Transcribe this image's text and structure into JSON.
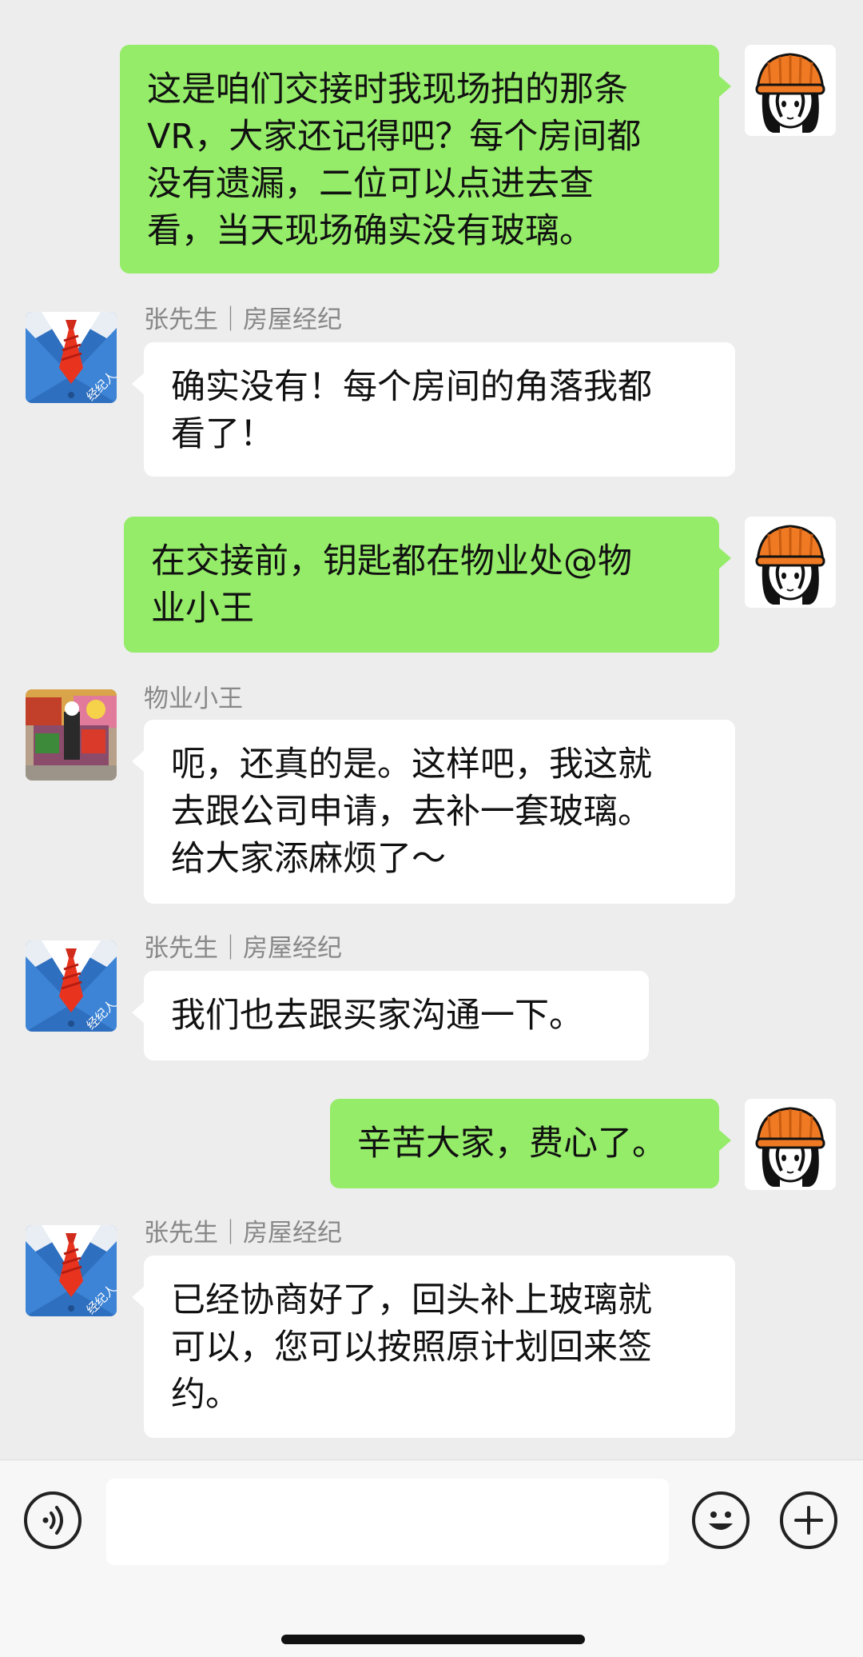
{
  "messages": [
    {
      "direction": "out",
      "sender": "",
      "avatar": "orange-hat-girl-avatar",
      "lines": [
        "这是咱们交接时我现场拍的那条",
        "VR，大家还记得吧？每个房间都",
        "没有遗漏，二位可以点进去查",
        "看，当天现场确实没有玻璃。"
      ]
    },
    {
      "direction": "in",
      "sender": "张先生｜房屋经纪",
      "avatar": "agent-suit-avatar",
      "lines": [
        "确实没有！每个房间的角落我都",
        "看了！"
      ]
    },
    {
      "direction": "out",
      "sender": "",
      "avatar": "orange-hat-girl-avatar",
      "lines": [
        "在交接前，钥匙都在物业处@物",
        "业小王"
      ]
    },
    {
      "direction": "in",
      "sender": "物业小王",
      "avatar": "photo-avatar",
      "lines": [
        "呃，还真的是。这样吧，我这就",
        "去跟公司申请，去补一套玻璃。",
        "给大家添麻烦了～"
      ]
    },
    {
      "direction": "in",
      "sender": "张先生｜房屋经纪",
      "avatar": "agent-suit-avatar",
      "lines": [
        "我们也去跟买家沟通一下。"
      ]
    },
    {
      "direction": "out",
      "sender": "",
      "avatar": "orange-hat-girl-avatar",
      "lines": [
        "辛苦大家，费心了。"
      ]
    },
    {
      "direction": "in",
      "sender": "张先生｜房屋经纪",
      "avatar": "agent-suit-avatar",
      "lines": [
        "已经协商好了，回头补上玻璃就",
        "可以，您可以按照原计划回来签",
        "约。"
      ]
    }
  ],
  "agent_badge": "经纪人",
  "input_bar": {
    "voice_icon": "voice-icon",
    "emoji_icon": "emoji-icon",
    "plus_icon": "plus-icon",
    "text_value": ""
  },
  "colors": {
    "background": "#ededed",
    "outgoing_bubble": "#95ec69",
    "incoming_bubble": "#ffffff",
    "sender_name": "#888888"
  }
}
